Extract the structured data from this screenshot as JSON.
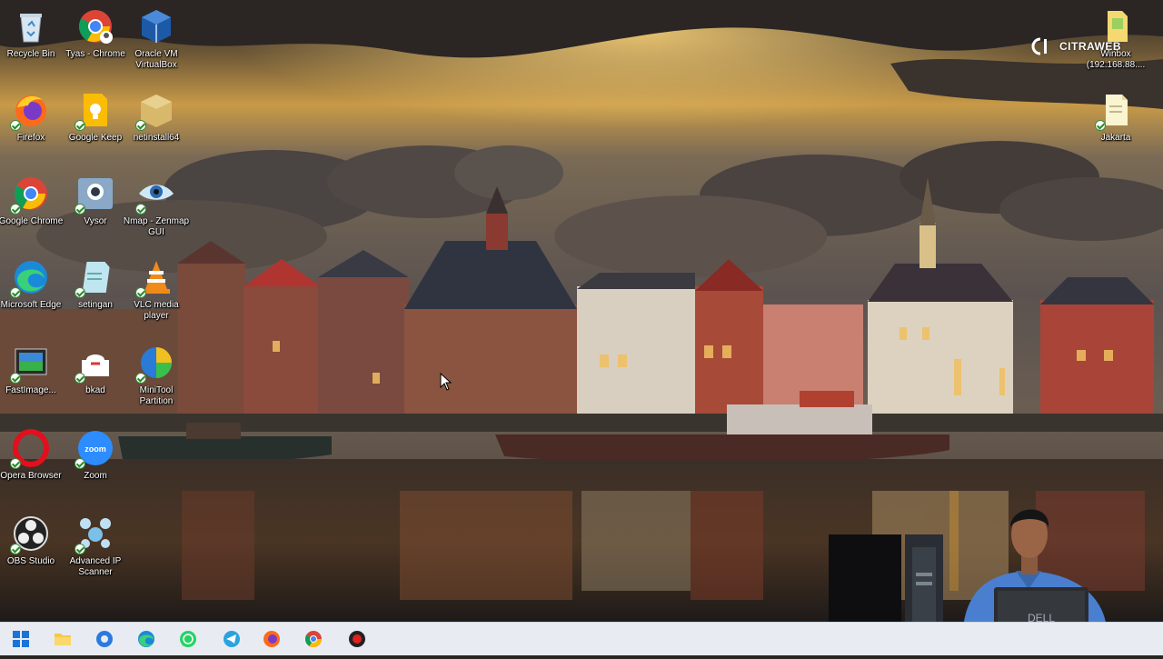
{
  "desktop": {
    "icons": [
      {
        "label": "Recycle Bin",
        "icon": "recycle-bin-icon",
        "badge": false
      },
      {
        "label": "Tyas - Chrome",
        "icon": "chrome-icon",
        "badge": false
      },
      {
        "label": "Oracle VM VirtualBox",
        "icon": "virtualbox-icon",
        "badge": false
      },
      {
        "label": "Firefox",
        "icon": "firefox-icon",
        "badge": true
      },
      {
        "label": "Google Keep",
        "icon": "google-keep-icon",
        "badge": true
      },
      {
        "label": "netinstall64",
        "icon": "package-icon",
        "badge": true
      },
      {
        "label": "Google Chrome",
        "icon": "chrome-icon",
        "badge": true
      },
      {
        "label": "Vysor",
        "icon": "vysor-icon",
        "badge": true
      },
      {
        "label": "Nmap - Zenmap GUI",
        "icon": "zenmap-eye-icon",
        "badge": true
      },
      {
        "label": "Microsoft Edge",
        "icon": "edge-icon",
        "badge": true
      },
      {
        "label": "setingan",
        "icon": "settings-file-icon",
        "badge": true
      },
      {
        "label": "VLC media player",
        "icon": "vlc-cone-icon",
        "badge": true
      },
      {
        "label": "FastImage...",
        "icon": "fastimage-icon",
        "badge": true
      },
      {
        "label": "bkad",
        "icon": "cloud-file-icon",
        "badge": true
      },
      {
        "label": "MiniTool Partition",
        "icon": "minitool-icon",
        "badge": true
      },
      {
        "label": "Opera Browser",
        "icon": "opera-icon",
        "badge": true
      },
      {
        "label": "Zoom",
        "icon": "zoom-icon",
        "badge": true
      },
      {
        "label": "OBS Studio",
        "icon": "obs-icon",
        "badge": true
      },
      {
        "label": "Advanced IP Scanner",
        "icon": "ip-scanner-icon",
        "badge": true
      }
    ],
    "right_icons": [
      {
        "label": "Winbox (192.168.88....",
        "icon": "winbox-folder-icon"
      },
      {
        "label": "Jakarta",
        "icon": "text-file-icon"
      }
    ],
    "watermark": "CITRAWEB"
  },
  "taskbar": {
    "buttons": [
      {
        "name": "start-icon"
      },
      {
        "name": "file-explorer-icon"
      },
      {
        "name": "edge-copilot-icon"
      },
      {
        "name": "edge-icon"
      },
      {
        "name": "whatsapp-icon"
      },
      {
        "name": "telegram-icon"
      },
      {
        "name": "firefox-icon"
      },
      {
        "name": "chrome-icon"
      },
      {
        "name": "record-icon"
      }
    ]
  },
  "webcam": {
    "laptop_brand": "DELL"
  },
  "colors": {
    "sky_gold": "#e8a93a",
    "cloud_dark": "#3a3230",
    "water": "#2b2524",
    "taskbar": "#e8ecf2",
    "shirt": "#4a7fd0"
  }
}
